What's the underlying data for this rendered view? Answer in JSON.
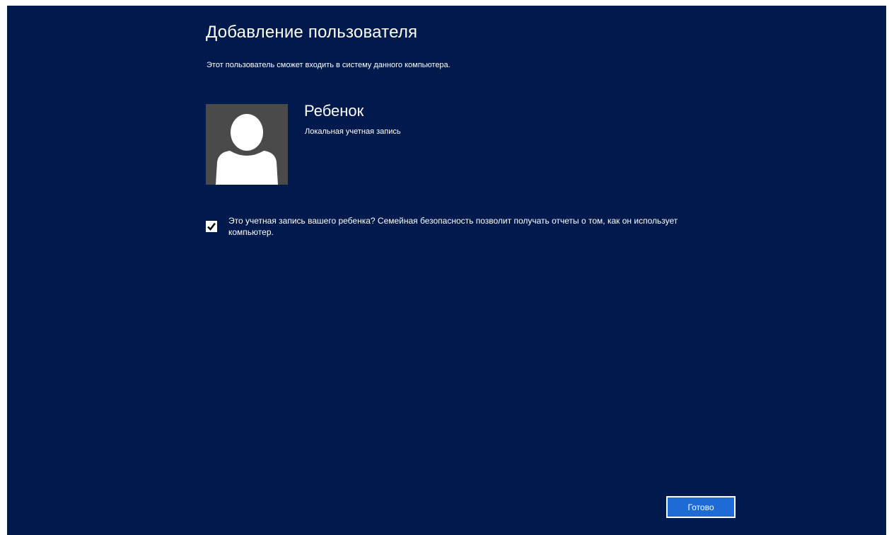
{
  "header": {
    "title": "Добавление пользователя",
    "subtitle": "Этот пользователь сможет входить в систему данного компьютера."
  },
  "account": {
    "avatar_icon": "user-silhouette-icon",
    "name": "Ребенок",
    "type": "Локальная учетная запись"
  },
  "family_safety": {
    "checked": true,
    "label": "Это учетная запись вашего ребенка? Семейная безопасность позволит получать отчеты о том, как он использует компьютер."
  },
  "footer": {
    "done_label": "Готово"
  },
  "colors": {
    "background": "#001a4d",
    "avatar_tile": "#4a4a4a",
    "button": "#1e6bd6",
    "text": "#ffffff"
  }
}
